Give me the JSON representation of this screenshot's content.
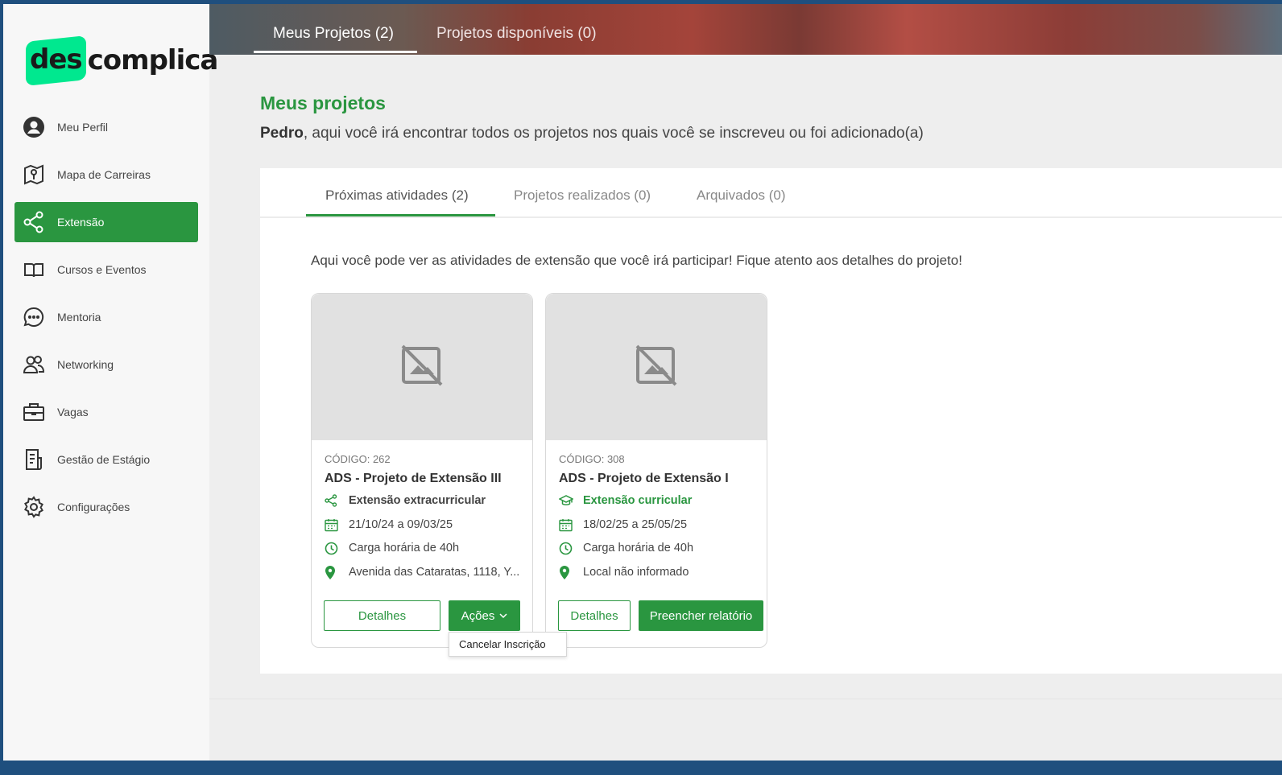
{
  "brand": {
    "logo_badge": "des",
    "logo_rest": "complica",
    "accent": "#2a9640",
    "logo_color": "#00e88f"
  },
  "sidebar": {
    "items": [
      {
        "label": "Meu Perfil",
        "icon": "user-circle-icon"
      },
      {
        "label": "Mapa de Carreiras",
        "icon": "map-pin-icon"
      },
      {
        "label": "Extensão",
        "icon": "share-icon",
        "active": true
      },
      {
        "label": "Cursos e Eventos",
        "icon": "book-icon"
      },
      {
        "label": "Mentoria",
        "icon": "chat-bubble-icon"
      },
      {
        "label": "Networking",
        "icon": "people-icon"
      },
      {
        "label": "Vagas",
        "icon": "briefcase-icon"
      },
      {
        "label": "Gestão de Estágio",
        "icon": "document-icon"
      },
      {
        "label": "Configurações",
        "icon": "gear-icon"
      }
    ]
  },
  "top_tabs": [
    {
      "label": "Meus Projetos (2)",
      "active": true
    },
    {
      "label": "Projetos disponíveis (0)",
      "active": false
    }
  ],
  "header": {
    "title": "Meus projetos",
    "subtitle_name": "Pedro",
    "subtitle_rest": ", aqui você irá encontrar todos os projetos nos quais você se inscreveu ou foi adicionado(a)"
  },
  "panel": {
    "tabs": [
      {
        "label": "Próximas atividades (2)",
        "active": true
      },
      {
        "label": "Projetos realizados (0)",
        "active": false
      },
      {
        "label": "Arquivados (0)",
        "active": false
      }
    ],
    "intro": "Aqui você pode ver as atividades de extensão que você irá participar! Fique atento aos detalhes do projeto!",
    "cards": [
      {
        "code": "CÓDIGO: 262",
        "title": "ADS - Projeto de Extensão III",
        "type": "Extensão extracurricular",
        "dates": "21/10/24 a 09/03/25",
        "hours": "Carga horária de 40h",
        "location": "Avenida das Cataratas, 1118, Y...",
        "btn_details": "Detalhes",
        "btn_actions": "Ações",
        "dropdown_item": "Cancelar Inscrição"
      },
      {
        "code": "CÓDIGO: 308",
        "title": "ADS - Projeto de Extensão I",
        "type": "Extensão curricular",
        "dates": "18/02/25 a 25/05/25",
        "hours": "Carga horária de 40h",
        "location": "Local não informado",
        "btn_details": "Detalhes",
        "btn_report": "Preencher relatório"
      }
    ]
  }
}
